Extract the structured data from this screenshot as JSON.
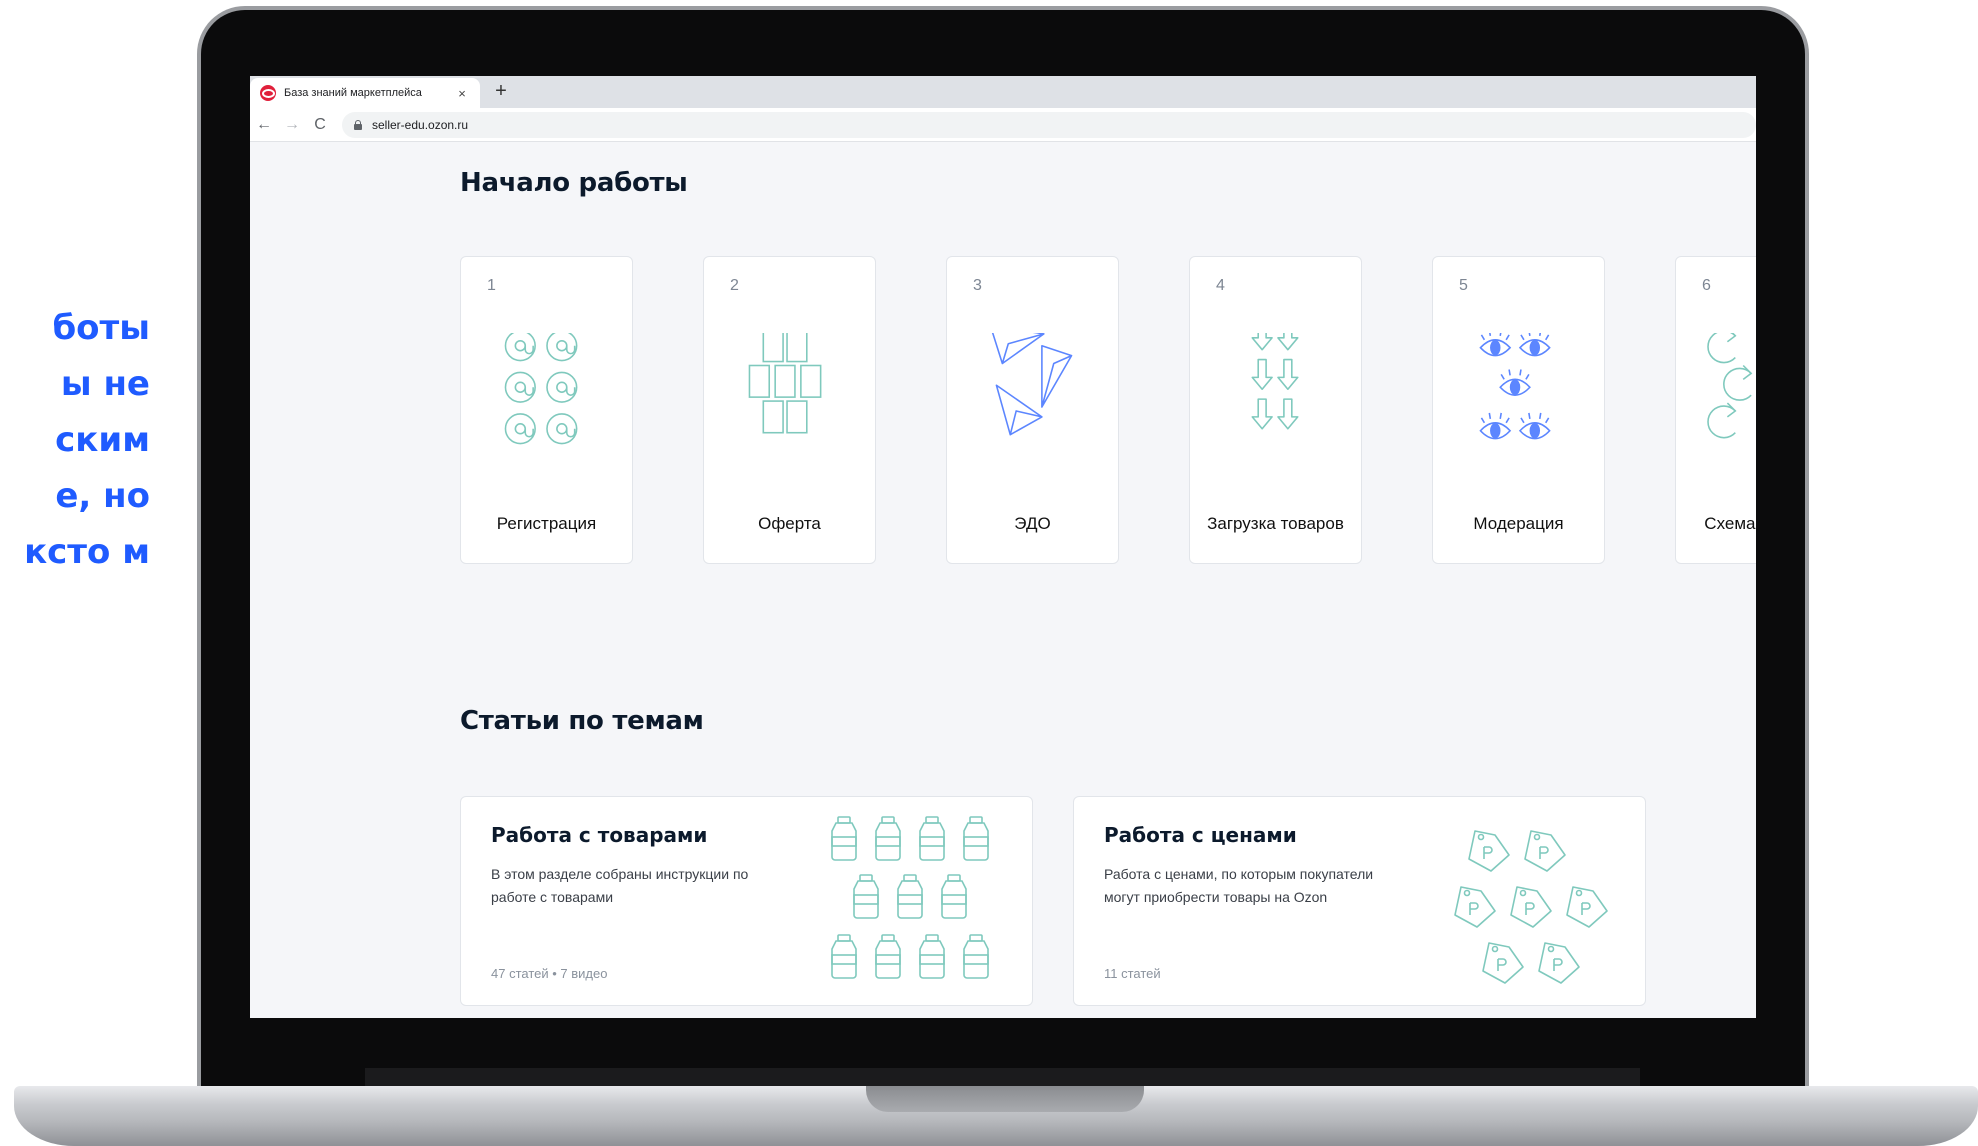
{
  "side_text": {
    "lines": [
      "боты",
      "ы не",
      "ским",
      "е, но",
      "ксто м"
    ]
  },
  "browser": {
    "tab_title": "База знаний маркетплейса",
    "tab_close": "×",
    "new_tab": "+",
    "back": "←",
    "forward": "→",
    "reload": "C",
    "url": "seller-edu.ozon.ru"
  },
  "page": {
    "start_title": "Начало работы",
    "topics_title": "Статьи по темам",
    "steps": [
      {
        "num": "1",
        "label": "Регистрация",
        "icon": "at-sign-icon"
      },
      {
        "num": "2",
        "label": "Оферта",
        "icon": "documents-icon"
      },
      {
        "num": "3",
        "label": "ЭДО",
        "icon": "paper-plane-icon"
      },
      {
        "num": "4",
        "label": "Загрузка товаров",
        "icon": "down-arrow-icon"
      },
      {
        "num": "5",
        "label": "Модерация",
        "icon": "eye-icon"
      },
      {
        "num": "6",
        "label": "Схема продаж",
        "icon": "refresh-icon"
      }
    ],
    "topics": [
      {
        "title": "Работа с товарами",
        "desc": "В этом разделе собраны инструкции по работе с товарами",
        "meta": "47 статей • 7 видео",
        "icon": "bottle-icon"
      },
      {
        "title": "Работа с ценами",
        "desc": "Работа с ценами, по которым покупатели могут приобрести товары на Ozon",
        "meta": "11 статей",
        "icon": "price-tag-icon"
      }
    ]
  },
  "colors": {
    "accent_blue": "#1f5bff",
    "icon_teal": "#7fc9bd",
    "icon_blue": "#5c86ff",
    "page_bg": "#f5f6f9"
  }
}
